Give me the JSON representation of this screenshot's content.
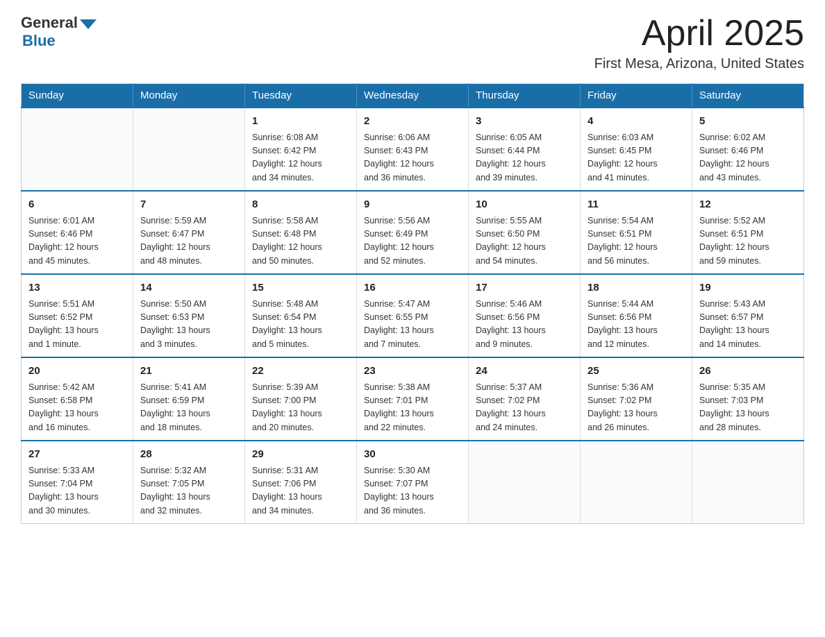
{
  "header": {
    "logo": {
      "text_general": "General",
      "text_blue": "Blue"
    },
    "title": "April 2025",
    "location": "First Mesa, Arizona, United States"
  },
  "calendar": {
    "days_of_week": [
      "Sunday",
      "Monday",
      "Tuesday",
      "Wednesday",
      "Thursday",
      "Friday",
      "Saturday"
    ],
    "weeks": [
      [
        {
          "day": "",
          "info": ""
        },
        {
          "day": "",
          "info": ""
        },
        {
          "day": "1",
          "info": "Sunrise: 6:08 AM\nSunset: 6:42 PM\nDaylight: 12 hours\nand 34 minutes."
        },
        {
          "day": "2",
          "info": "Sunrise: 6:06 AM\nSunset: 6:43 PM\nDaylight: 12 hours\nand 36 minutes."
        },
        {
          "day": "3",
          "info": "Sunrise: 6:05 AM\nSunset: 6:44 PM\nDaylight: 12 hours\nand 39 minutes."
        },
        {
          "day": "4",
          "info": "Sunrise: 6:03 AM\nSunset: 6:45 PM\nDaylight: 12 hours\nand 41 minutes."
        },
        {
          "day": "5",
          "info": "Sunrise: 6:02 AM\nSunset: 6:46 PM\nDaylight: 12 hours\nand 43 minutes."
        }
      ],
      [
        {
          "day": "6",
          "info": "Sunrise: 6:01 AM\nSunset: 6:46 PM\nDaylight: 12 hours\nand 45 minutes."
        },
        {
          "day": "7",
          "info": "Sunrise: 5:59 AM\nSunset: 6:47 PM\nDaylight: 12 hours\nand 48 minutes."
        },
        {
          "day": "8",
          "info": "Sunrise: 5:58 AM\nSunset: 6:48 PM\nDaylight: 12 hours\nand 50 minutes."
        },
        {
          "day": "9",
          "info": "Sunrise: 5:56 AM\nSunset: 6:49 PM\nDaylight: 12 hours\nand 52 minutes."
        },
        {
          "day": "10",
          "info": "Sunrise: 5:55 AM\nSunset: 6:50 PM\nDaylight: 12 hours\nand 54 minutes."
        },
        {
          "day": "11",
          "info": "Sunrise: 5:54 AM\nSunset: 6:51 PM\nDaylight: 12 hours\nand 56 minutes."
        },
        {
          "day": "12",
          "info": "Sunrise: 5:52 AM\nSunset: 6:51 PM\nDaylight: 12 hours\nand 59 minutes."
        }
      ],
      [
        {
          "day": "13",
          "info": "Sunrise: 5:51 AM\nSunset: 6:52 PM\nDaylight: 13 hours\nand 1 minute."
        },
        {
          "day": "14",
          "info": "Sunrise: 5:50 AM\nSunset: 6:53 PM\nDaylight: 13 hours\nand 3 minutes."
        },
        {
          "day": "15",
          "info": "Sunrise: 5:48 AM\nSunset: 6:54 PM\nDaylight: 13 hours\nand 5 minutes."
        },
        {
          "day": "16",
          "info": "Sunrise: 5:47 AM\nSunset: 6:55 PM\nDaylight: 13 hours\nand 7 minutes."
        },
        {
          "day": "17",
          "info": "Sunrise: 5:46 AM\nSunset: 6:56 PM\nDaylight: 13 hours\nand 9 minutes."
        },
        {
          "day": "18",
          "info": "Sunrise: 5:44 AM\nSunset: 6:56 PM\nDaylight: 13 hours\nand 12 minutes."
        },
        {
          "day": "19",
          "info": "Sunrise: 5:43 AM\nSunset: 6:57 PM\nDaylight: 13 hours\nand 14 minutes."
        }
      ],
      [
        {
          "day": "20",
          "info": "Sunrise: 5:42 AM\nSunset: 6:58 PM\nDaylight: 13 hours\nand 16 minutes."
        },
        {
          "day": "21",
          "info": "Sunrise: 5:41 AM\nSunset: 6:59 PM\nDaylight: 13 hours\nand 18 minutes."
        },
        {
          "day": "22",
          "info": "Sunrise: 5:39 AM\nSunset: 7:00 PM\nDaylight: 13 hours\nand 20 minutes."
        },
        {
          "day": "23",
          "info": "Sunrise: 5:38 AM\nSunset: 7:01 PM\nDaylight: 13 hours\nand 22 minutes."
        },
        {
          "day": "24",
          "info": "Sunrise: 5:37 AM\nSunset: 7:02 PM\nDaylight: 13 hours\nand 24 minutes."
        },
        {
          "day": "25",
          "info": "Sunrise: 5:36 AM\nSunset: 7:02 PM\nDaylight: 13 hours\nand 26 minutes."
        },
        {
          "day": "26",
          "info": "Sunrise: 5:35 AM\nSunset: 7:03 PM\nDaylight: 13 hours\nand 28 minutes."
        }
      ],
      [
        {
          "day": "27",
          "info": "Sunrise: 5:33 AM\nSunset: 7:04 PM\nDaylight: 13 hours\nand 30 minutes."
        },
        {
          "day": "28",
          "info": "Sunrise: 5:32 AM\nSunset: 7:05 PM\nDaylight: 13 hours\nand 32 minutes."
        },
        {
          "day": "29",
          "info": "Sunrise: 5:31 AM\nSunset: 7:06 PM\nDaylight: 13 hours\nand 34 minutes."
        },
        {
          "day": "30",
          "info": "Sunrise: 5:30 AM\nSunset: 7:07 PM\nDaylight: 13 hours\nand 36 minutes."
        },
        {
          "day": "",
          "info": ""
        },
        {
          "day": "",
          "info": ""
        },
        {
          "day": "",
          "info": ""
        }
      ]
    ]
  }
}
